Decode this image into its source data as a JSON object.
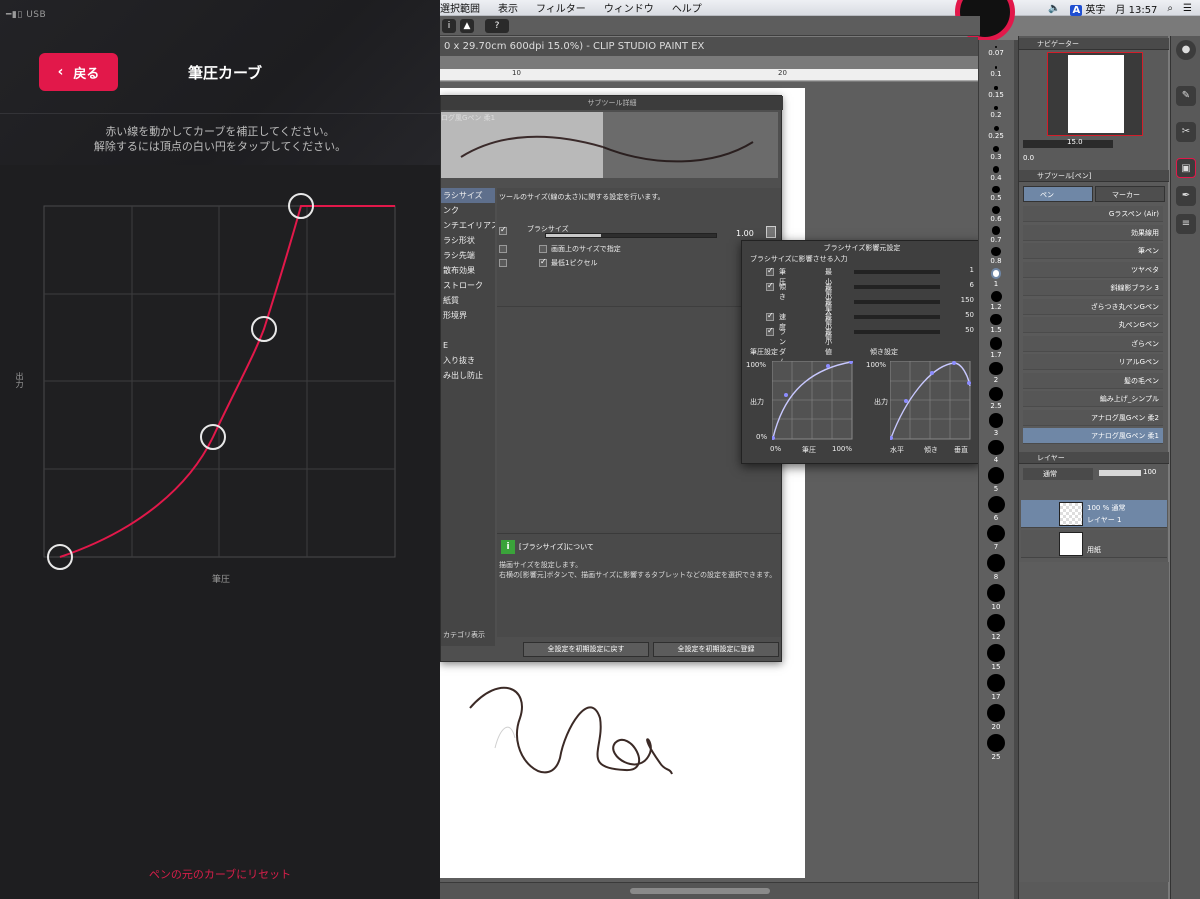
{
  "left_panel": {
    "status_usb": "USB",
    "back_label": "戻る",
    "title": "筆圧カーブ",
    "instruction_line1": "赤い線を動かしてカーブを補正してください。",
    "instruction_line2": "解除するには頂点の白い円をタップしてください。",
    "axis_y": "出力",
    "axis_x": "筆圧",
    "reset_label": "ペンの元のカーブにリセット",
    "accent_color": "#e2184a"
  },
  "menubar": {
    "items": [
      "選択範囲",
      "表示",
      "フィルター",
      "ウィンドウ",
      "ヘルプ"
    ],
    "ime": "英字",
    "clock": "月 13:57"
  },
  "document": {
    "title": "0 x 29.70cm 600dpi 15.0%)  - CLIP STUDIO PAINT EX",
    "ruler_marks": [
      "10",
      "20"
    ]
  },
  "subtool_dialog": {
    "title": "サブツール詳細",
    "tab": "ログ風Gペン 柔1",
    "categories": [
      "ラシサイズ",
      "ンク",
      "ンチエイリアス",
      "ラシ形状",
      "ラシ先端",
      "散布効果",
      "ストローク",
      "紙質",
      "形境界",
      "",
      "E",
      "入り抜き",
      "み出し防止"
    ],
    "category_footer": "カテゴリ表示",
    "description": "ツールのサイズ(線の太さ)に関する設定を行います。",
    "brush_size_label": "ブラシサイズ",
    "brush_size_value": "1.00",
    "screen_size_label": "画面上のサイズで指定",
    "min_pixel_label": "最低1ピクセル",
    "info_title": "[ブラシサイズ]について",
    "info_line1": "描画サイズを設定します。",
    "info_line2": "右横の[影響元]ボタンで、描画サイズに影響するタブレットなどの設定を選択できます。",
    "btn_reset": "全設定を初期設定に戻す",
    "btn_register": "全設定を初期設定に登録"
  },
  "popup": {
    "title": "ブラシサイズ影響元設定",
    "subtitle": "ブラシサイズに影響させる入力",
    "rows": [
      {
        "label": "筆圧",
        "min_label": "最小値",
        "value": "1"
      },
      {
        "label": "傾き",
        "min_label": "最小値",
        "value": "6"
      },
      {
        "label": "",
        "min_label": "最大値",
        "value": "150"
      },
      {
        "label": "速度",
        "min_label": "最小値",
        "value": "50"
      },
      {
        "label": "ランダム",
        "min_label": "最小値",
        "value": "50"
      }
    ],
    "pressure_title": "筆圧設定",
    "tilt_title": "傾き設定",
    "output_label": "出力",
    "pct100": "100%",
    "pct0": "0%",
    "pressure_x": [
      "0%",
      "筆圧",
      "100%"
    ],
    "tilt_x": [
      "水平",
      "傾き",
      "垂直"
    ]
  },
  "brush_sizes": [
    "0.07",
    "0.1",
    "0.15",
    "0.2",
    "0.25",
    "0.3",
    "0.4",
    "0.5",
    "0.6",
    "0.7",
    "0.8",
    "1",
    "1.2",
    "1.5",
    "1.7",
    "2",
    "2.5",
    "3",
    "4",
    "5",
    "6",
    "7",
    "8",
    "10",
    "12",
    "15",
    "17",
    "20",
    "25"
  ],
  "navigator": {
    "title": "ナビゲーター",
    "zoom": "15.0",
    "angle": "0.0"
  },
  "subtool_panel": {
    "title": "サブツール[ペン]",
    "tab_pen": "ペン",
    "tab_marker": "マーカー",
    "brushes": [
      "Gラスペン (Air)",
      "効果線用",
      "筆ペン",
      "ツヤベタ",
      "斜線影ブラシ 3",
      "ざらつき丸ペンGペン",
      "丸ペンGペン",
      "ざらペン",
      "リアルGペン",
      "髪の毛ペン",
      "編み上げ_シンプル",
      "アナログ風Gペン 柔2",
      "アナログ風Gペン 柔1"
    ]
  },
  "layers": {
    "title": "レイヤー",
    "blend_mode": "通常",
    "opacity": "100",
    "layer1_mode": "100 % 通常",
    "layer1_name": "レイヤー 1",
    "paper_name": "用紙"
  }
}
